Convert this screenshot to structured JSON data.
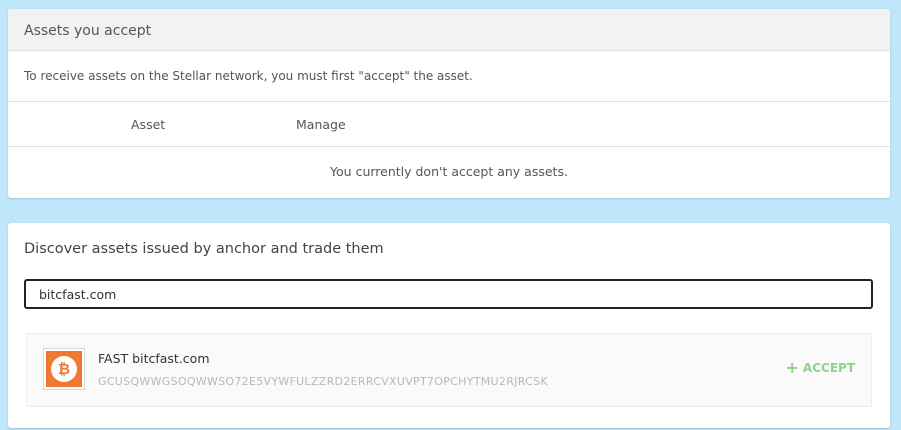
{
  "accepted": {
    "title": "Assets you accept",
    "description": "To receive assets on the Stellar network, you must first \"accept\" the asset.",
    "columns": [
      "Asset",
      "Manage"
    ],
    "empty_message": "You currently don't accept any assets."
  },
  "discover": {
    "title": "Discover assets issued by anchor and trade them",
    "search_value": "bitcfast.com",
    "results": [
      {
        "code": "FAST",
        "domain": "bitcfast.com",
        "issuer": "GCUSQWWGSOQWWSO72E5VYWFULZZRD2ERRCVXUVPT7OPCHYTMU2RJRCSK",
        "logo_icon": "bitcoin-icon",
        "logo_glyph": "₿",
        "accept_label": "ACCEPT",
        "accept_icon": "plus-icon"
      }
    ]
  },
  "colors": {
    "background": "#bfe7fb",
    "accept_green": "#8ad58e",
    "bitcoin_orange": "#ee7a31"
  }
}
